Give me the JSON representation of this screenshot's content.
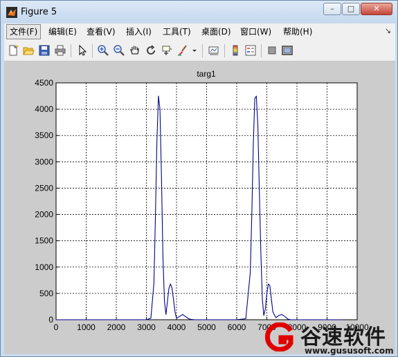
{
  "window": {
    "title": "Figure 5",
    "controls": {
      "minimize": "–",
      "restore": "□",
      "close": "✕"
    }
  },
  "menubar": {
    "items": [
      {
        "label": "文件(F)",
        "active": true
      },
      {
        "label": "编辑(E)"
      },
      {
        "label": "查看(V)"
      },
      {
        "label": "插入(I)"
      },
      {
        "label": "工具(T)"
      },
      {
        "label": "桌面(D)"
      },
      {
        "label": "窗口(W)"
      },
      {
        "label": "帮助(H)"
      }
    ],
    "overflow_glyph": "↘"
  },
  "toolbar": {
    "icons": [
      "new-figure-icon",
      "open-file-icon",
      "save-icon",
      "print-icon",
      "pointer-icon",
      "zoom-in-icon",
      "zoom-out-icon",
      "pan-hand-icon",
      "rotate-3d-icon",
      "data-cursor-icon",
      "brush-icon",
      "brush-dropdown-icon",
      "link-plot-icon",
      "colorbar-icon",
      "legend-icon",
      "hide-plot-tools-icon",
      "show-plot-tools-icon"
    ]
  },
  "colors": {
    "plot_line": "#00008b",
    "figure_bg": "#cccccc",
    "axes_bg": "#ffffff"
  },
  "chart_data": {
    "type": "line",
    "title": "targ1",
    "xlabel": "",
    "ylabel": "",
    "xlim": [
      0,
      10000
    ],
    "ylim": [
      0,
      4500
    ],
    "xticks": [
      0,
      1000,
      2000,
      3000,
      4000,
      5000,
      6000,
      7000,
      8000,
      9000,
      10000
    ],
    "yticks": [
      0,
      500,
      1000,
      1500,
      2000,
      2500,
      3000,
      3500,
      4000,
      4500
    ],
    "grid": true,
    "grid_style": "dotted",
    "series": [
      {
        "x": [
          0,
          3000,
          3150,
          3250,
          3300,
          3350,
          3400,
          3450,
          3500,
          3550,
          3600,
          3650,
          3700,
          3750,
          3800,
          3850,
          3900,
          3950,
          4000,
          4100,
          4200,
          4300,
          4400,
          4500,
          4600,
          5000,
          6000,
          6300,
          6450,
          6500,
          6550,
          6600,
          6650,
          6700,
          6750,
          6800,
          6850,
          6900,
          6950,
          7000,
          7050,
          7100,
          7150,
          7200,
          7300,
          7400,
          7500,
          7600,
          7700,
          7800,
          8000,
          8500,
          9000,
          9500
        ],
        "y": [
          0,
          0,
          30,
          700,
          2000,
          3400,
          4250,
          4000,
          2700,
          1200,
          350,
          100,
          350,
          600,
          680,
          600,
          380,
          150,
          30,
          60,
          100,
          60,
          20,
          5,
          0,
          0,
          0,
          20,
          900,
          2000,
          3300,
          4200,
          4250,
          3700,
          2500,
          1300,
          400,
          80,
          200,
          500,
          680,
          650,
          400,
          150,
          40,
          80,
          100,
          60,
          10,
          0,
          0,
          0,
          0,
          0
        ]
      }
    ]
  },
  "watermark": {
    "text": "谷速软件",
    "url": "www.gususoft.com"
  }
}
